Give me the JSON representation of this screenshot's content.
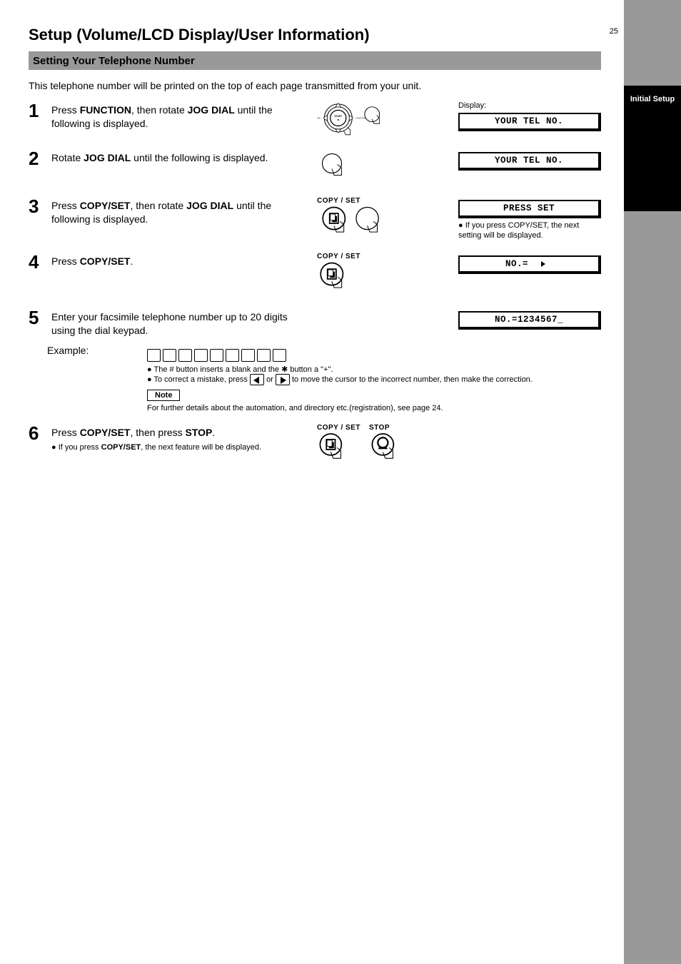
{
  "page": {
    "number": "25"
  },
  "sidebar": {
    "label": "Initial Setup"
  },
  "title": "Setup (Volume/LCD Display/User Information)",
  "subsection": "Setting Your Telephone Number",
  "intro": "This telephone number will be printed on the top of each page transmitted from your unit.",
  "steps": [
    {
      "num": "1",
      "text_a": "Press ",
      "bold_a": "FUNCTION",
      "text_b": ", then rotate ",
      "bold_b": "JOG DIAL",
      "text_c": " until the following is displayed.",
      "lcd_head": "Display:",
      "lcd": "YOUR TEL NO."
    },
    {
      "num": "2",
      "text_a": "Rotate ",
      "bold_a": "JOG DIAL",
      "text_b": " until the following is displayed.",
      "lcd_head": "",
      "lcd": "YOUR TEL NO.",
      "lcd_note": ""
    },
    {
      "num": "3",
      "text_a": "Press ",
      "bold_a": "COPY/SET",
      "text_b": ", then rotate ",
      "bold_b": "JOG DIAL",
      "text_c": " until the following is displayed.",
      "icon_label": "COPY / SET",
      "lcd_head": "",
      "lcd": "PRESS SET",
      "lcd_note_a": "● If you press ",
      "lcd_note_bold": "COPY/SET",
      "lcd_note_b": ", the next setting will be displayed."
    },
    {
      "num": "4",
      "text_a": "Press ",
      "bold_a": "COPY/SET",
      "text_b": ".",
      "icon_label": "COPY / SET",
      "lcd_head": "",
      "lcd_a": "NO.=",
      "lcd_b": "",
      "lcd_note": ""
    },
    {
      "num": "5",
      "text_a": "Enter your facsimile telephone number up to 20 digits using the dial keypad.",
      "lcd_head": "",
      "lcd": "NO.=1234567_",
      "lcd_note": "",
      "example_label": "Example:",
      "bullet1": "● The # button inserts a blank and the ✱ button a \"+\".",
      "bullet2_a": "● To correct a mistake, press ",
      "bullet2_b": " or ",
      "bullet2_c": " to move the cursor to the incorrect number, then make the correction.",
      "note_head": "Note",
      "note_text": "For further details about the automation, and directory etc.(registration), see page 24."
    },
    {
      "num": "6",
      "text_a": "Press ",
      "bold_a": "COPY/SET",
      "text_b": ", then press ",
      "bold_b": "STOP",
      "text_c": ".",
      "icon_label_a": "COPY / SET",
      "icon_label_b": "STOP",
      "sub_a": "● If you press ",
      "sub_bold": "COPY/SET",
      "sub_b": ", the next feature will be displayed."
    }
  ]
}
